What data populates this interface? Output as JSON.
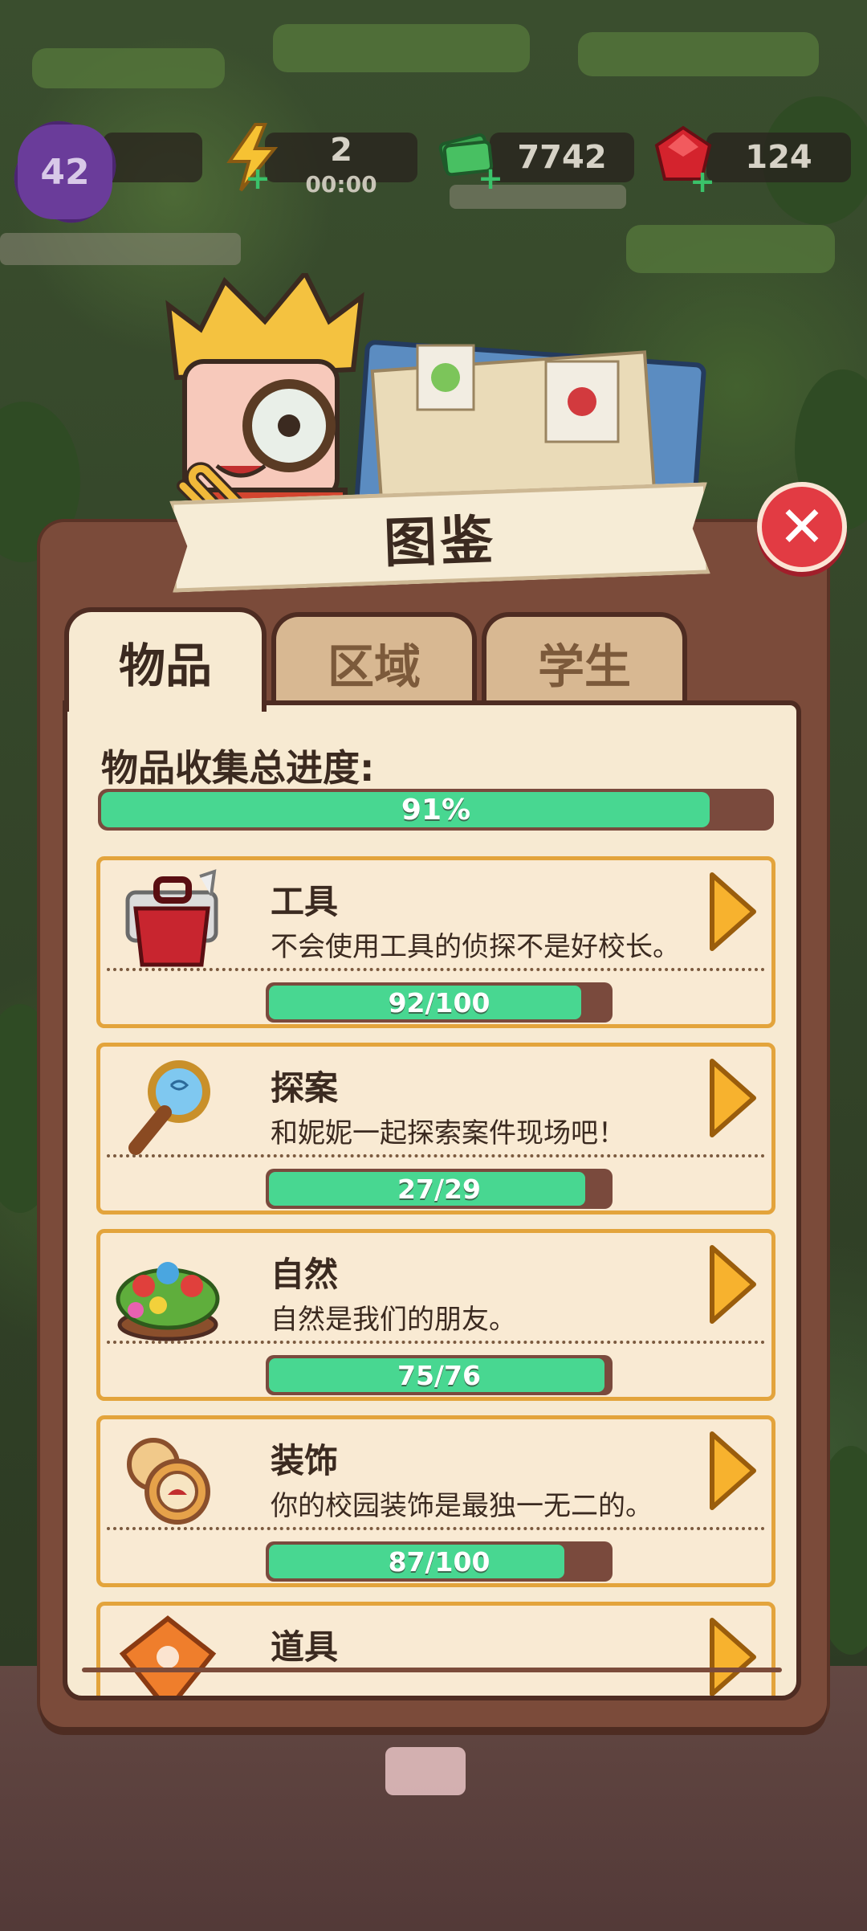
{
  "hud": {
    "level": "42",
    "energy": "2",
    "energy_timer": "00:00",
    "cash": "7742",
    "gems": "124"
  },
  "title": "图鉴",
  "tabs": [
    {
      "label": "物品",
      "active": true
    },
    {
      "label": "区域",
      "active": false
    },
    {
      "label": "学生",
      "active": false
    }
  ],
  "overall": {
    "label": "物品收集总进度:",
    "progress_text": "91%",
    "progress": 0.91
  },
  "categories": [
    {
      "name": "工具",
      "desc": "不会使用工具的侦探不是好校长。",
      "progress_text": "92/100",
      "progress": 0.92,
      "icon": "toolbox-icon"
    },
    {
      "name": "探案",
      "desc": "和妮妮一起探索案件现场吧！",
      "progress_text": "27/29",
      "progress": 0.931,
      "icon": "magnifier-icon"
    },
    {
      "name": "自然",
      "desc": "自然是我们的朋友。",
      "progress_text": "75/76",
      "progress": 0.987,
      "icon": "flower-bush-icon"
    },
    {
      "name": "装饰",
      "desc": "你的校园装饰是最独一无二的。",
      "progress_text": "87/100",
      "progress": 0.87,
      "icon": "pocket-watch-icon"
    },
    {
      "name": "道具",
      "desc": "",
      "progress_text": "",
      "progress": 0,
      "icon": "orange-dice-icon"
    }
  ],
  "colors": {
    "panel": "#7b4b3a",
    "panel_dark": "#4e2c22",
    "paper": "#f7ead2",
    "progress_fill": "#48d791",
    "card_border": "#e3a43c",
    "arrow": "#f7b22e",
    "close": "#e23b43"
  }
}
